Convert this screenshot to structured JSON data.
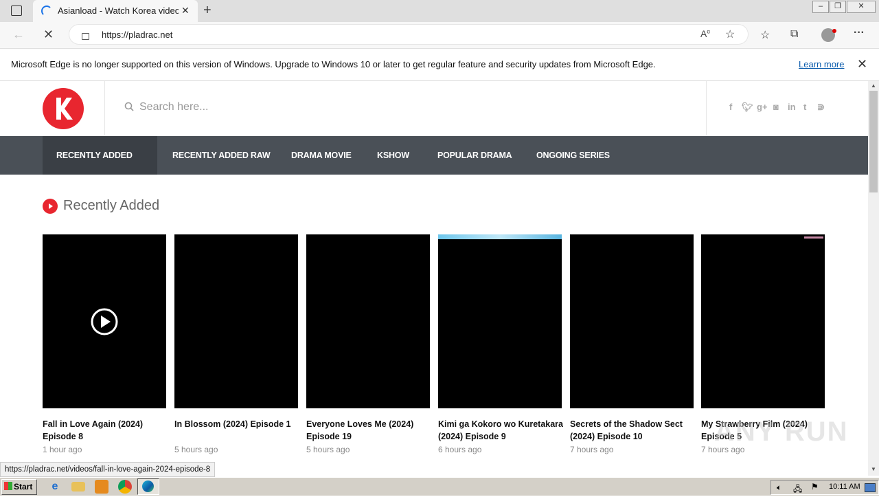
{
  "browser": {
    "tab_title": "Asianload - Watch Korea videos f",
    "url": "https://pladrac.net",
    "window_controls": [
      "minimize-icon",
      "restore-icon",
      "close-icon"
    ]
  },
  "infobar": {
    "message": "Microsoft Edge is no longer supported on this version of Windows. Upgrade to Windows 10 or later to get regular feature and security updates from Microsoft Edge.",
    "learn_more": "Learn more"
  },
  "site": {
    "search_placeholder": "Search here...",
    "social_icons": [
      "facebook-icon",
      "twitter-icon",
      "google-plus-icon",
      "instagram-icon",
      "linkedin-icon",
      "tumblr-icon",
      "rss-icon"
    ],
    "nav": [
      {
        "label": "RECENTLY ADDED SUB",
        "active": true
      },
      {
        "label": "RECENTLY ADDED RAW",
        "active": false
      },
      {
        "label": "DRAMA MOVIE",
        "active": false
      },
      {
        "label": "KSHOW",
        "active": false
      },
      {
        "label": "POPULAR DRAMA",
        "active": false
      },
      {
        "label": "ONGOING SERIES",
        "active": false
      }
    ],
    "section_title": "Recently Added",
    "cards": [
      {
        "title": "Fall in Love Again (2024) Episode 8",
        "time": "1 hour ago"
      },
      {
        "title": "In Blossom (2024) Episode 1",
        "time": "5 hours ago"
      },
      {
        "title": "Everyone Loves Me (2024) Episode 19",
        "time": "5 hours ago"
      },
      {
        "title": "Kimi ga Kokoro wo Kuretakara (2024) Episode 9",
        "time": "6 hours ago"
      },
      {
        "title": "Secrets of the Shadow Sect (2024) Episode 10",
        "time": "7 hours ago"
      },
      {
        "title": "My Strawberry Film (2024) Episode 5",
        "time": "7 hours ago"
      }
    ]
  },
  "status_url": "https://pladrac.net/videos/fall-in-love-again-2024-episode-8",
  "taskbar": {
    "start_label": "Start",
    "clock": "10:11 AM"
  },
  "watermark": "ANY RUN",
  "colors": {
    "accent": "#e8262f",
    "nav_bg": "#4a5057"
  }
}
